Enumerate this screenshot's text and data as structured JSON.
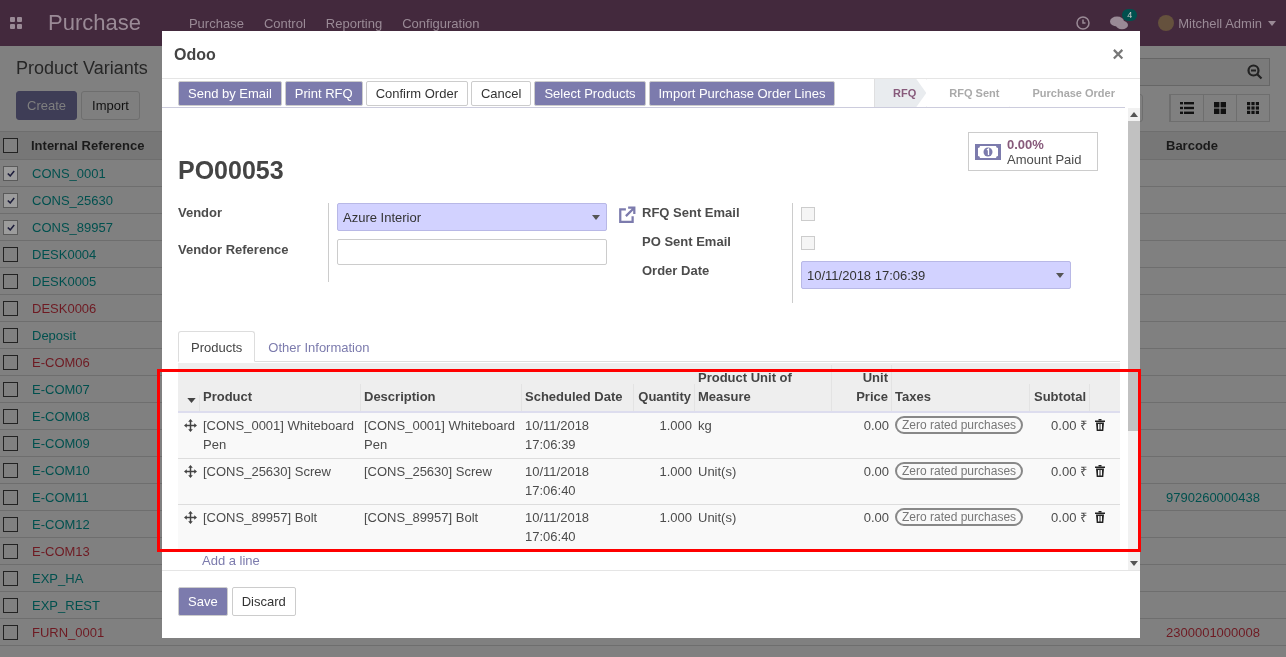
{
  "navbar": {
    "brand": "Purchase",
    "menus": [
      "Purchase",
      "Control",
      "Reporting",
      "Configuration"
    ],
    "message_count": "4",
    "user": "Mitchell Admin"
  },
  "page": {
    "title": "Product Variants",
    "all_checked": false,
    "buttons": [
      {
        "label": "Create",
        "primary": true
      },
      {
        "label": "Import",
        "primary": false
      }
    ],
    "columns": [
      "Internal Reference",
      "Barcode"
    ],
    "rows": [
      {
        "reference": "CONS_0001",
        "checked": true,
        "color": "#00504e"
      },
      {
        "reference": "CONS_25630",
        "checked": true,
        "color": "#00504e"
      },
      {
        "reference": "CONS_89957",
        "checked": true,
        "color": "#00504e"
      },
      {
        "reference": "DESK0004",
        "checked": false,
        "color": "#00504e"
      },
      {
        "reference": "DESK0005",
        "checked": false,
        "color": "#00504e"
      },
      {
        "reference": "DESK0006",
        "checked": false,
        "color": "#6e1a22"
      },
      {
        "reference": "Deposit",
        "checked": false,
        "color": "#00504e"
      },
      {
        "reference": "E-COM06",
        "checked": false,
        "color": "#6e1a22"
      },
      {
        "reference": "E-COM07",
        "checked": false,
        "color": "#00504e"
      },
      {
        "reference": "E-COM08",
        "checked": false,
        "color": "#00504e"
      },
      {
        "reference": "E-COM09",
        "checked": false,
        "color": "#00504e"
      },
      {
        "reference": "E-COM10",
        "checked": false,
        "color": "#00504e"
      },
      {
        "reference": "E-COM11",
        "barcode": "9790260000438",
        "checked": false,
        "color": "#00504e"
      },
      {
        "reference": "E-COM12",
        "checked": false,
        "color": "#00504e"
      },
      {
        "reference": "E-COM13",
        "checked": false,
        "color": "#6e1a22"
      },
      {
        "reference": "EXP_HA",
        "checked": false,
        "color": "#00504e"
      },
      {
        "reference": "EXP_REST",
        "checked": false,
        "color": "#00504e"
      },
      {
        "reference": "FURN_0001",
        "barcode": "2300001000008",
        "checked": false,
        "color": "#6e1a22"
      }
    ]
  },
  "dialog": {
    "title": "Odoo",
    "close": "×",
    "header_buttons": [
      {
        "label": "Send by Email",
        "primary": true
      },
      {
        "label": "Print RFQ",
        "primary": true
      },
      {
        "label": "Confirm Order",
        "primary": false
      },
      {
        "label": "Cancel",
        "primary": false
      },
      {
        "label": "Select Products",
        "primary": true
      },
      {
        "label": "Import Purchase Order Lines",
        "primary": true
      }
    ],
    "stages": [
      {
        "label": "RFQ",
        "selected": true
      },
      {
        "label": "RFQ Sent",
        "selected": false
      },
      {
        "label": "Purchase Order",
        "selected": false
      }
    ],
    "amount_paid": {
      "value": "0.00%",
      "label": "Amount Paid"
    },
    "reference": "PO00053",
    "fields_left": [
      {
        "label": "Vendor",
        "kind": "select",
        "value": "Azure Interior"
      },
      {
        "label": "Vendor Reference",
        "kind": "input"
      }
    ],
    "fields_right": [
      {
        "label": "RFQ Sent Email",
        "kind": "checkbox",
        "checked": false
      },
      {
        "label": "PO Sent Email",
        "kind": "checkbox",
        "checked": false
      },
      {
        "label": "Order Date",
        "kind": "select",
        "value": "10/11/2018 17:06:39"
      }
    ],
    "tabs": [
      {
        "label": "Products",
        "selected": true
      },
      {
        "label": "Other Information",
        "selected": false
      }
    ],
    "table": {
      "columns": [
        "Product",
        "Description",
        "Scheduled Date",
        "Quantity",
        "Product Unit of Measure",
        "Unit Price",
        "Taxes",
        "Subtotal"
      ],
      "rows": [
        {
          "product": "[CONS_0001] Whiteboard Pen",
          "description": "[CONS_0001] Whiteboard Pen",
          "date": "10/11/2018 17:06:39",
          "quantity": "1.000",
          "uom": "kg",
          "price": "0.00",
          "tax": "Zero rated purchases",
          "subtotal": "0.00 ₹"
        },
        {
          "product": "[CONS_25630] Screw",
          "description": "[CONS_25630] Screw",
          "date": "10/11/2018 17:06:40",
          "quantity": "1.000",
          "uom": "Unit(s)",
          "price": "0.00",
          "tax": "Zero rated purchases",
          "subtotal": "0.00 ₹"
        },
        {
          "product": "[CONS_89957] Bolt",
          "description": "[CONS_89957] Bolt",
          "date": "10/11/2018 17:06:40",
          "quantity": "1.000",
          "uom": "Unit(s)",
          "price": "0.00",
          "tax": "Zero rated purchases",
          "subtotal": "0.00 ₹"
        }
      ],
      "add_line": "Add a line"
    },
    "footer_buttons": [
      {
        "label": "Save",
        "primary": true
      },
      {
        "label": "Discard",
        "primary": false
      }
    ]
  }
}
